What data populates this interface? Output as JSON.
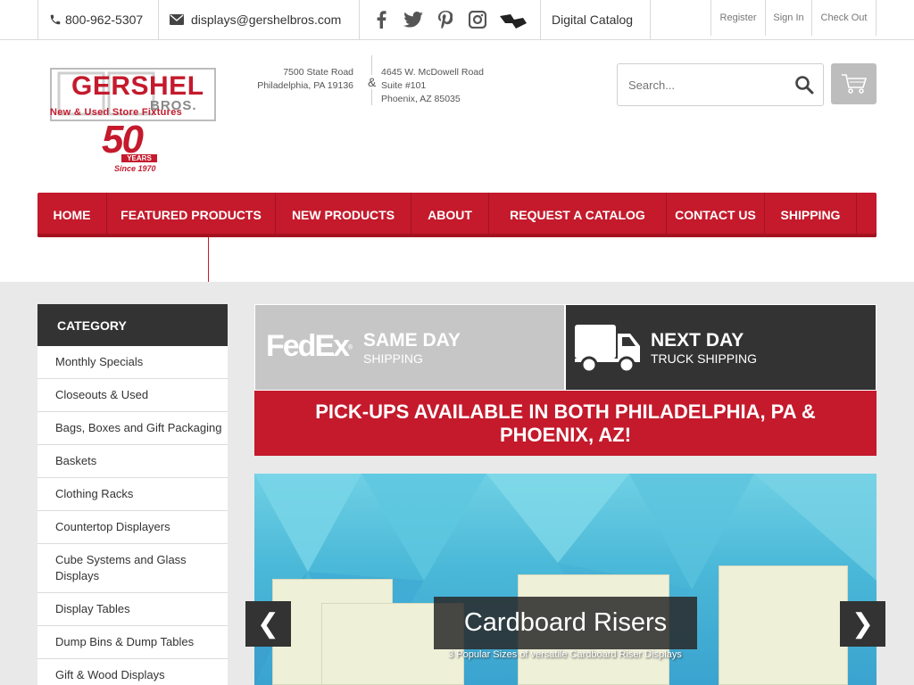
{
  "topbar": {
    "phone": "800-962-5307",
    "email": "displays@gershelbros.com",
    "social": [
      "facebook-icon",
      "twitter-icon",
      "pinterest-icon",
      "instagram-icon",
      "houzz-icon"
    ],
    "catalog": "Digital Catalog",
    "account": {
      "register": "Register",
      "sign_in": "Sign In",
      "check_out": "Check Out"
    }
  },
  "logo": {
    "name": "GERSHEL",
    "bros": "BROS.",
    "tagline": "New & Used Store Fixtures",
    "fifty": "50",
    "years": "YEARS",
    "since": "Since 1970"
  },
  "address": {
    "left": [
      "7500 State Road",
      "Philadelphia, PA 19136"
    ],
    "amp": "&",
    "right": [
      "4645 W. McDowell Road",
      "Suite #101",
      "Phoenix, AZ 85035"
    ]
  },
  "search": {
    "placeholder": "Search..."
  },
  "nav": [
    "HOME",
    "FEATURED PRODUCTS",
    "NEW PRODUCTS",
    "ABOUT",
    "REQUEST A CATALOG",
    "CONTACT US",
    "SHIPPING"
  ],
  "sidebar": {
    "heading": "CATEGORY",
    "items": [
      "Monthly Specials",
      "Closeouts & Used",
      "Bags, Boxes and Gift Packaging",
      "Baskets",
      "Clothing Racks",
      "Countertop Displayers",
      "Cube Systems and Glass Displays",
      "Display Tables",
      "Dump Bins & Dump Tables",
      "Gift & Wood Displays"
    ]
  },
  "shipping": {
    "left": {
      "logo": "FedEx",
      "title": "SAME DAY",
      "sub": "SHIPPING"
    },
    "right": {
      "title": "NEXT DAY",
      "sub": "TRUCK SHIPPING"
    }
  },
  "pickup": "PICK-UPS AVAILABLE IN BOTH PHILADELPHIA, PA & PHOENIX, AZ!",
  "slider": {
    "title": "Cardboard Risers",
    "caption": "3 Popular Sizes of versatile Cardboard Riser Displays",
    "prev": "❮",
    "next": "❯"
  },
  "colors": {
    "brand_red": "#c41a2c",
    "dark": "#333333",
    "gray_panel": "#c6c6c6"
  }
}
